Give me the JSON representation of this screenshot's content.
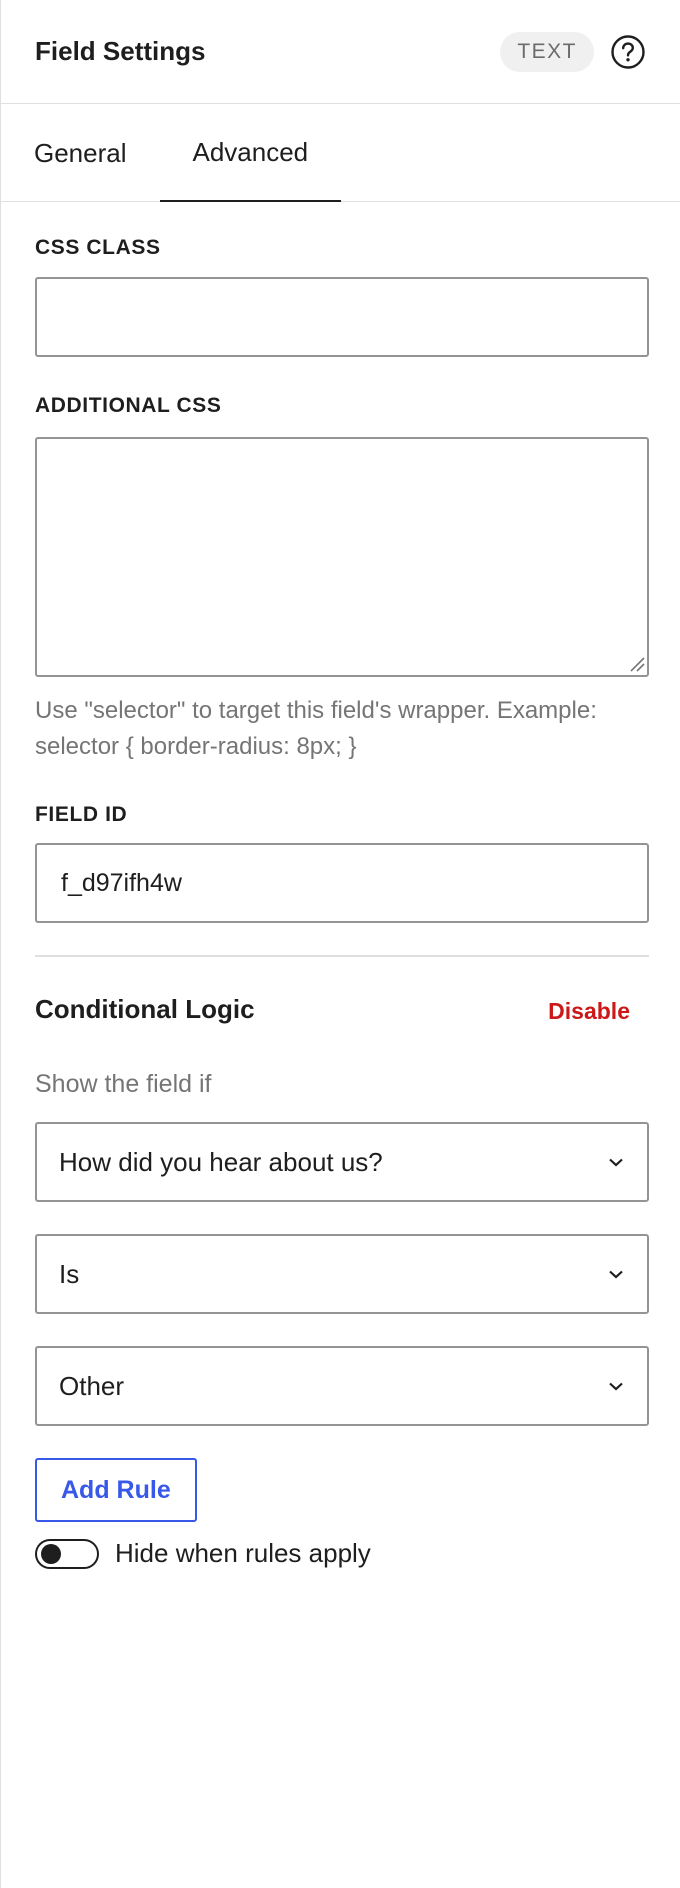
{
  "header": {
    "title": "Field Settings",
    "type_badge": "TEXT",
    "help_icon": "help-circle-icon"
  },
  "tabs": [
    {
      "label": "General",
      "active": false
    },
    {
      "label": "Advanced",
      "active": true
    }
  ],
  "fields": {
    "css_class": {
      "label": "CSS CLASS",
      "value": ""
    },
    "additional_css": {
      "label": "ADDITIONAL CSS",
      "value": "",
      "help": "Use \"selector\" to target this field's wrapper. Example: selector { border-radius: 8px; }"
    },
    "field_id": {
      "label": "FIELD ID",
      "value": "f_d97ifh4w"
    }
  },
  "conditional_logic": {
    "title": "Conditional Logic",
    "disable_label": "Disable",
    "show_if_label": "Show the field if",
    "rules": [
      {
        "field": "How did you hear about us?",
        "operator": "Is",
        "value": "Other"
      }
    ],
    "add_rule_label": "Add Rule",
    "hide_toggle": {
      "label": "Hide when rules apply",
      "on": false
    }
  },
  "colors": {
    "accent": "#3858e9",
    "danger": "#cc1818",
    "muted_text": "#757575",
    "border": "#949494"
  }
}
